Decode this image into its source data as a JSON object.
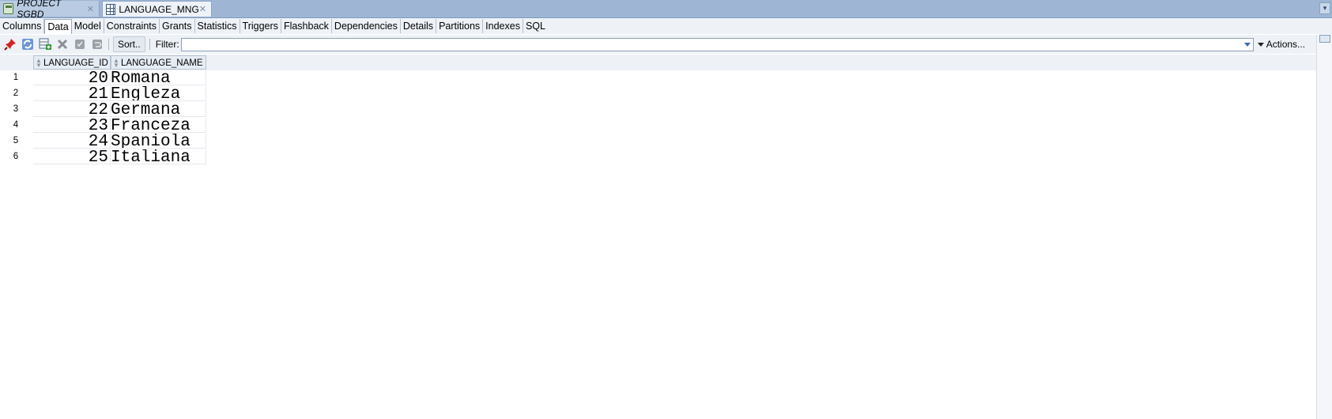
{
  "doc_tabs": [
    {
      "label": "PROJECT SGBD",
      "icon": "database-connection-icon",
      "active": false
    },
    {
      "label": "LANGUAGE_MNG",
      "icon": "table-grid-icon",
      "active": true
    }
  ],
  "object_tabs": [
    "Columns",
    "Data",
    "Model",
    "Constraints",
    "Grants",
    "Statistics",
    "Triggers",
    "Flashback",
    "Dependencies",
    "Details",
    "Partitions",
    "Indexes",
    "SQL"
  ],
  "selected_object_tab": "Data",
  "toolbar": {
    "icons": [
      "freeze-pin-icon",
      "refresh-icon",
      "insert-row-icon",
      "delete-row-icon",
      "commit-icon",
      "rollback-icon"
    ],
    "sort_label": "Sort..",
    "filter_label": "Filter:",
    "filter_value": "",
    "actions_label": "Actions..."
  },
  "grid": {
    "columns": [
      "LANGUAGE_ID",
      "LANGUAGE_NAME"
    ],
    "rows": [
      {
        "num": "1",
        "id": "20",
        "name": "Romana"
      },
      {
        "num": "2",
        "id": "21",
        "name": "Engleza"
      },
      {
        "num": "3",
        "id": "22",
        "name": "Germana"
      },
      {
        "num": "4",
        "id": "23",
        "name": "Franceza"
      },
      {
        "num": "5",
        "id": "24",
        "name": "Spaniola"
      },
      {
        "num": "6",
        "id": "25",
        "name": "Italiana"
      }
    ]
  },
  "colors": {
    "tabbar_bg": "#9eb6d4",
    "panel_bg": "#eef2f7",
    "accent": "#3a6bb0"
  }
}
